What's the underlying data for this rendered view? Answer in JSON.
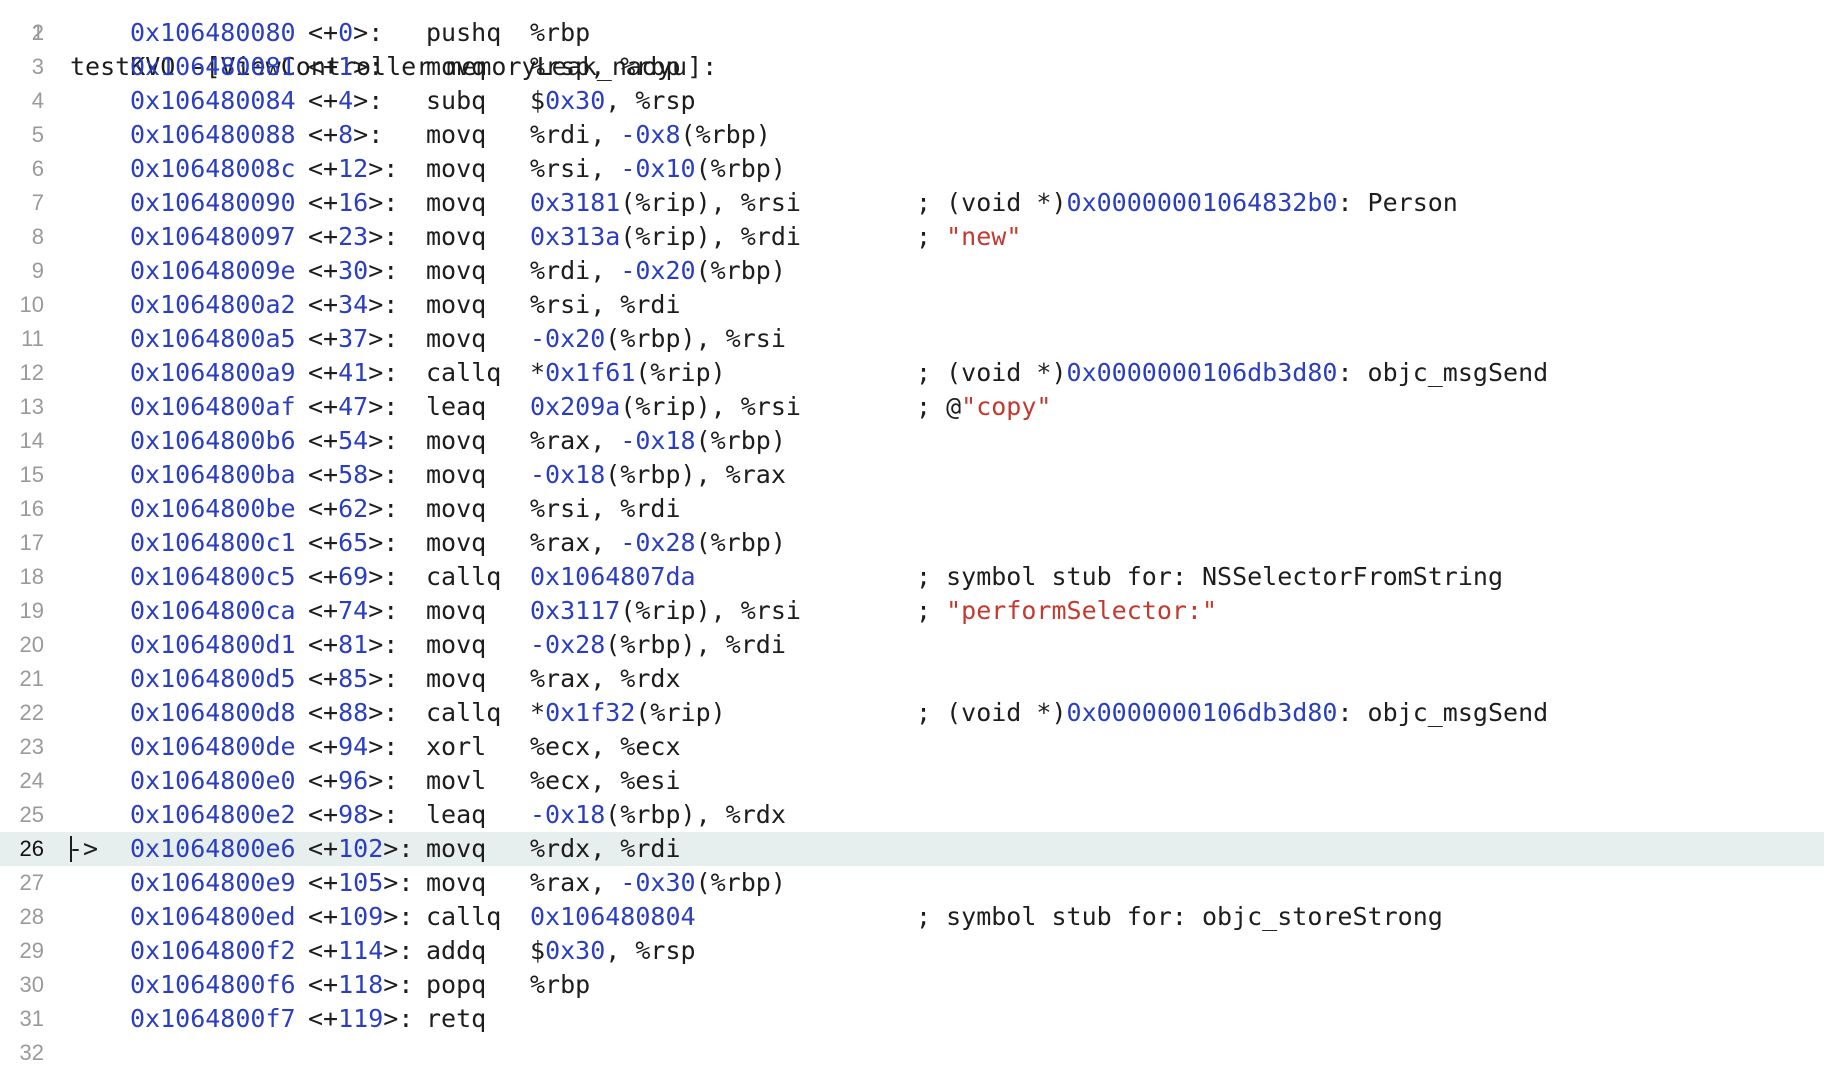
{
  "header": {
    "line_number": "1",
    "title": "testKVO -[ViewController memoryLeak_naoyu]:"
  },
  "pc_marker": "->",
  "lines": [
    {
      "n": "2",
      "addr": "0x106480080",
      "off": "<+0>:",
      "mn": "pushq",
      "op": "%rbp",
      "cm": ""
    },
    {
      "n": "3",
      "addr": "0x106480081",
      "off": "<+1>:",
      "mn": "movq",
      "op": "%rsp, %rbp",
      "cm": ""
    },
    {
      "n": "4",
      "addr": "0x106480084",
      "off": "<+4>:",
      "mn": "subq",
      "op": "$0x30, %rsp",
      "cm": ""
    },
    {
      "n": "5",
      "addr": "0x106480088",
      "off": "<+8>:",
      "mn": "movq",
      "op": "%rdi, -0x8(%rbp)",
      "cm": ""
    },
    {
      "n": "6",
      "addr": "0x10648008c",
      "off": "<+12>:",
      "mn": "movq",
      "op": "%rsi, -0x10(%rbp)",
      "cm": ""
    },
    {
      "n": "7",
      "addr": "0x106480090",
      "off": "<+16>:",
      "mn": "movq",
      "op": "0x3181(%rip), %rsi",
      "cm": "; (void *)0x00000001064832b0: Person"
    },
    {
      "n": "8",
      "addr": "0x106480097",
      "off": "<+23>:",
      "mn": "movq",
      "op": "0x313a(%rip), %rdi",
      "cm": "; \"new\""
    },
    {
      "n": "9",
      "addr": "0x10648009e",
      "off": "<+30>:",
      "mn": "movq",
      "op": "%rdi, -0x20(%rbp)",
      "cm": ""
    },
    {
      "n": "10",
      "addr": "0x1064800a2",
      "off": "<+34>:",
      "mn": "movq",
      "op": "%rsi, %rdi",
      "cm": ""
    },
    {
      "n": "11",
      "addr": "0x1064800a5",
      "off": "<+37>:",
      "mn": "movq",
      "op": "-0x20(%rbp), %rsi",
      "cm": ""
    },
    {
      "n": "12",
      "addr": "0x1064800a9",
      "off": "<+41>:",
      "mn": "callq",
      "op": "*0x1f61(%rip)",
      "cm": "; (void *)0x0000000106db3d80: objc_msgSend"
    },
    {
      "n": "13",
      "addr": "0x1064800af",
      "off": "<+47>:",
      "mn": "leaq",
      "op": "0x209a(%rip), %rsi",
      "cm": "; @\"copy\""
    },
    {
      "n": "14",
      "addr": "0x1064800b6",
      "off": "<+54>:",
      "mn": "movq",
      "op": "%rax, -0x18(%rbp)",
      "cm": ""
    },
    {
      "n": "15",
      "addr": "0x1064800ba",
      "off": "<+58>:",
      "mn": "movq",
      "op": "-0x18(%rbp), %rax",
      "cm": ""
    },
    {
      "n": "16",
      "addr": "0x1064800be",
      "off": "<+62>:",
      "mn": "movq",
      "op": "%rsi, %rdi",
      "cm": ""
    },
    {
      "n": "17",
      "addr": "0x1064800c1",
      "off": "<+65>:",
      "mn": "movq",
      "op": "%rax, -0x28(%rbp)",
      "cm": ""
    },
    {
      "n": "18",
      "addr": "0x1064800c5",
      "off": "<+69>:",
      "mn": "callq",
      "op": "0x1064807da",
      "cm": "; symbol stub for: NSSelectorFromString"
    },
    {
      "n": "19",
      "addr": "0x1064800ca",
      "off": "<+74>:",
      "mn": "movq",
      "op": "0x3117(%rip), %rsi",
      "cm": "; \"performSelector:\""
    },
    {
      "n": "20",
      "addr": "0x1064800d1",
      "off": "<+81>:",
      "mn": "movq",
      "op": "-0x28(%rbp), %rdi",
      "cm": ""
    },
    {
      "n": "21",
      "addr": "0x1064800d5",
      "off": "<+85>:",
      "mn": "movq",
      "op": "%rax, %rdx",
      "cm": ""
    },
    {
      "n": "22",
      "addr": "0x1064800d8",
      "off": "<+88>:",
      "mn": "callq",
      "op": "*0x1f32(%rip)",
      "cm": "; (void *)0x0000000106db3d80: objc_msgSend"
    },
    {
      "n": "23",
      "addr": "0x1064800de",
      "off": "<+94>:",
      "mn": "xorl",
      "op": "%ecx, %ecx",
      "cm": ""
    },
    {
      "n": "24",
      "addr": "0x1064800e0",
      "off": "<+96>:",
      "mn": "movl",
      "op": "%ecx, %esi",
      "cm": ""
    },
    {
      "n": "25",
      "addr": "0x1064800e2",
      "off": "<+98>:",
      "mn": "leaq",
      "op": "-0x18(%rbp), %rdx",
      "cm": ""
    },
    {
      "n": "26",
      "addr": "0x1064800e6",
      "off": "<+102>:",
      "mn": "movq",
      "op": "%rdx, %rdi",
      "cm": "",
      "current": true
    },
    {
      "n": "27",
      "addr": "0x1064800e9",
      "off": "<+105>:",
      "mn": "movq",
      "op": "%rax, -0x30(%rbp)",
      "cm": ""
    },
    {
      "n": "28",
      "addr": "0x1064800ed",
      "off": "<+109>:",
      "mn": "callq",
      "op": "0x106480804",
      "cm": "; symbol stub for: objc_storeStrong"
    },
    {
      "n": "29",
      "addr": "0x1064800f2",
      "off": "<+114>:",
      "mn": "addq",
      "op": "$0x30, %rsp",
      "cm": ""
    },
    {
      "n": "30",
      "addr": "0x1064800f6",
      "off": "<+118>:",
      "mn": "popq",
      "op": "%rbp",
      "cm": ""
    },
    {
      "n": "31",
      "addr": "0x1064800f7",
      "off": "<+119>:",
      "mn": "retq",
      "op": "",
      "cm": ""
    },
    {
      "n": "32",
      "addr": "",
      "off": "",
      "mn": "",
      "op": "",
      "cm": ""
    }
  ],
  "colors": {
    "number": "#2a3ec3",
    "string": "#c4392f",
    "text": "#1d1d1d",
    "line_number": "#9a9a9a",
    "current_line_bg": "#e6eeee"
  }
}
